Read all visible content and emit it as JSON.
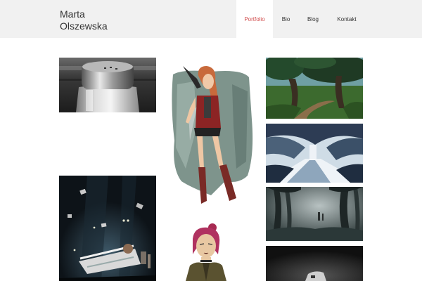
{
  "site": {
    "author_first": "Marta",
    "author_last": "Olszewska"
  },
  "nav": {
    "items": [
      {
        "label": "Portfolio",
        "active": true
      },
      {
        "label": "Bio",
        "active": false
      },
      {
        "label": "Blog",
        "active": false
      },
      {
        "label": "Kontakt",
        "active": false
      }
    ]
  },
  "colors": {
    "header_bg": "#f1f1f1",
    "accent": "#d14d4d",
    "text": "#333333"
  },
  "portfolio": {
    "thumbnails": [
      {
        "subject": "salt shaker photo"
      },
      {
        "subject": "redhead girl in red jacket and boots"
      },
      {
        "subject": "green forest path painting"
      },
      {
        "subject": "blue stormy sky and road painting"
      },
      {
        "subject": "misty dark forest with figures"
      },
      {
        "subject": "dark scene with figure in bed and flying papers"
      },
      {
        "subject": "pink haired girl character"
      },
      {
        "subject": "dark monochrome object photo"
      }
    ]
  }
}
